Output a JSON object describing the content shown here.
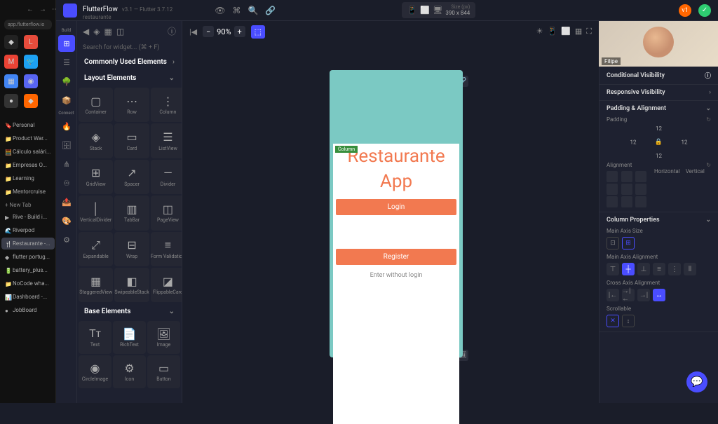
{
  "browser": {
    "url": "app.flutterflow.io",
    "tabs": [
      {
        "label": "Personal",
        "icon": "🔖"
      },
      {
        "label": "Product War...",
        "icon": "📁"
      },
      {
        "label": "Cálculo salári...",
        "icon": "🧮"
      },
      {
        "label": "Empresas O...",
        "icon": "📁"
      },
      {
        "label": "Learning",
        "icon": "📁"
      },
      {
        "label": "Mentorcruise",
        "icon": "📁"
      },
      {
        "label": "New Tab",
        "icon": "+"
      },
      {
        "label": "Rive - Build i...",
        "icon": "▶"
      },
      {
        "label": "Riverpod",
        "icon": "🌊"
      },
      {
        "label": "Restaurante -...",
        "icon": "🍴",
        "active": true
      },
      {
        "label": "flutter portug...",
        "icon": "◆"
      },
      {
        "label": "battery_plus...",
        "icon": "🔋"
      },
      {
        "label": "NoCode wha...",
        "icon": "📁"
      },
      {
        "label": "Dashboard -...",
        "icon": "📊"
      },
      {
        "label": "JobBoard",
        "icon": "●"
      }
    ]
  },
  "header": {
    "app_name": "FlutterFlow",
    "version": "v3.1 — Flutter 3.7.12",
    "project_name": "restaurante",
    "size_label": "Size (px)",
    "size_value": "390 x 844",
    "avatar_badge": "v1"
  },
  "rail": {
    "labels": [
      "Build",
      "Connect"
    ]
  },
  "widgets": {
    "search_placeholder": "Search for widget... (⌘ + F)",
    "section_common": "Commonly Used Elements",
    "section_layout": "Layout Elements",
    "section_base": "Base Elements",
    "layout_items": [
      {
        "label": "Container",
        "icon": "▢"
      },
      {
        "label": "Row",
        "icon": "⋯"
      },
      {
        "label": "Column",
        "icon": "⋮"
      },
      {
        "label": "Stack",
        "icon": "◈"
      },
      {
        "label": "Card",
        "icon": "▭"
      },
      {
        "label": "ListView",
        "icon": "☰"
      },
      {
        "label": "GridView",
        "icon": "⊞"
      },
      {
        "label": "Spacer",
        "icon": "↗"
      },
      {
        "label": "Divider",
        "icon": "—"
      },
      {
        "label": "VerticalDivider",
        "icon": "│"
      },
      {
        "label": "TabBar",
        "icon": "▥"
      },
      {
        "label": "PageView",
        "icon": "◫"
      },
      {
        "label": "Expandable",
        "icon": "⤢"
      },
      {
        "label": "Wrap",
        "icon": "⊟"
      },
      {
        "label": "Form Validation",
        "icon": "≡"
      },
      {
        "label": "StaggeredView",
        "icon": "▦"
      },
      {
        "label": "SwipeableStack",
        "icon": "◧"
      },
      {
        "label": "FlippableCard",
        "icon": "◪"
      }
    ],
    "base_items": [
      {
        "label": "Text",
        "icon": "Tᴛ"
      },
      {
        "label": "RichText",
        "icon": "📄"
      },
      {
        "label": "Image",
        "icon": "🖼"
      },
      {
        "label": "CircleImage",
        "icon": "◉"
      },
      {
        "label": "Icon",
        "icon": "⚙"
      },
      {
        "label": "Button",
        "icon": "▭"
      }
    ]
  },
  "canvas": {
    "zoom": "90%",
    "column_badge": "Column"
  },
  "preview": {
    "title_line1": "Restaurante",
    "title_line2": "App",
    "login_btn": "Login",
    "register_btn": "Register",
    "guest_link": "Enter without login"
  },
  "props": {
    "conditional_visibility": "Conditional Visibility",
    "responsive_visibility": "Responsive Visibility",
    "padding_alignment": "Padding & Alignment",
    "padding_label": "Padding",
    "padding": {
      "top": "12",
      "right": "12",
      "bottom": "12",
      "left": "12"
    },
    "alignment_label": "Alignment",
    "align_h": "Horizontal",
    "align_v": "Vertical",
    "column_properties": "Column Properties",
    "main_axis_size": "Main Axis Size",
    "main_axis_alignment": "Main Axis Alignment",
    "cross_axis_alignment": "Cross Axis Alignment",
    "scrollable": "Scrollable"
  },
  "webcam": {
    "name": "Filipe"
  }
}
